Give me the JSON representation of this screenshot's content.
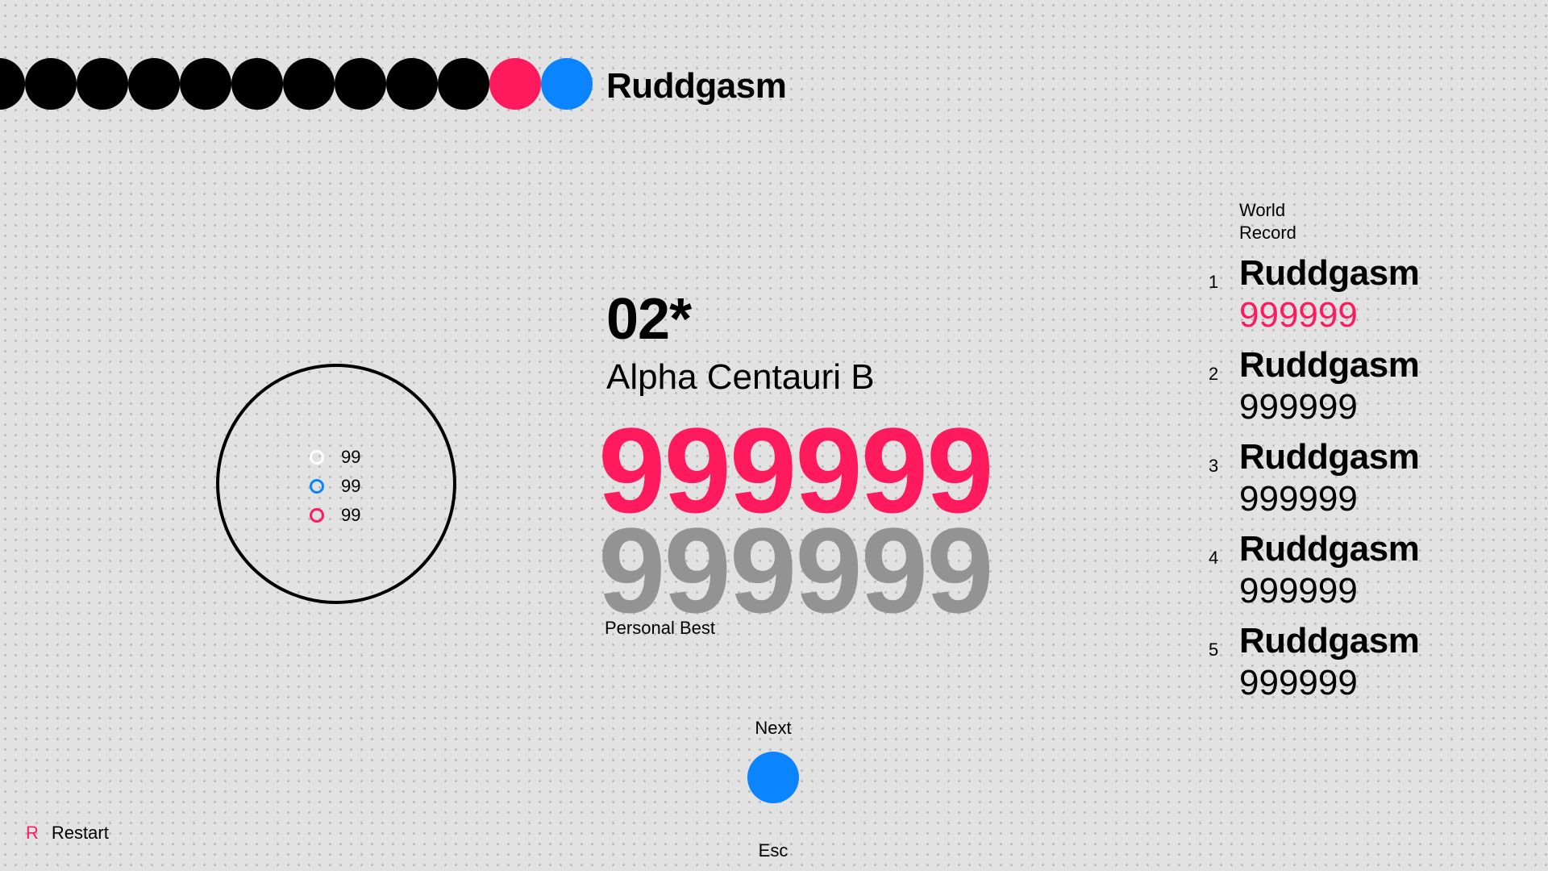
{
  "colors": {
    "accent_pink": "#ff1a5e",
    "accent_blue": "#0a84ff",
    "score_gray": "#939393",
    "dot_black": "#000000",
    "judge_white": "#ffffff"
  },
  "header": {
    "player_name": "Ruddgasm",
    "progress_dots": [
      "black",
      "black",
      "black",
      "black",
      "black",
      "black",
      "black",
      "black",
      "black",
      "black",
      "pink",
      "blue"
    ]
  },
  "level": {
    "number": "02*",
    "name": "Alpha Centauri B"
  },
  "score": {
    "current": "999999",
    "personal_best": "999999",
    "personal_best_label": "Personal Best"
  },
  "judgements": [
    {
      "icon": "white-ring-icon",
      "color": "#ffffff",
      "count": "99"
    },
    {
      "icon": "blue-ring-icon",
      "color": "#0a84ff",
      "count": "99"
    },
    {
      "icon": "pink-ring-icon",
      "color": "#ff1a5e",
      "count": "99"
    }
  ],
  "leaderboard": {
    "title_line1": "World",
    "title_line2": "Record",
    "entries": [
      {
        "rank": "1",
        "name": "Ruddgasm",
        "score": "999999",
        "highlight": true
      },
      {
        "rank": "2",
        "name": "Ruddgasm",
        "score": "999999",
        "highlight": false
      },
      {
        "rank": "3",
        "name": "Ruddgasm",
        "score": "999999",
        "highlight": false
      },
      {
        "rank": "4",
        "name": "Ruddgasm",
        "score": "999999",
        "highlight": false
      },
      {
        "rank": "5",
        "name": "Ruddgasm",
        "score": "999999",
        "highlight": false
      }
    ]
  },
  "controls": {
    "next_label": "Next",
    "esc_label": "Esc",
    "restart_key": "R",
    "restart_label": "Restart"
  }
}
